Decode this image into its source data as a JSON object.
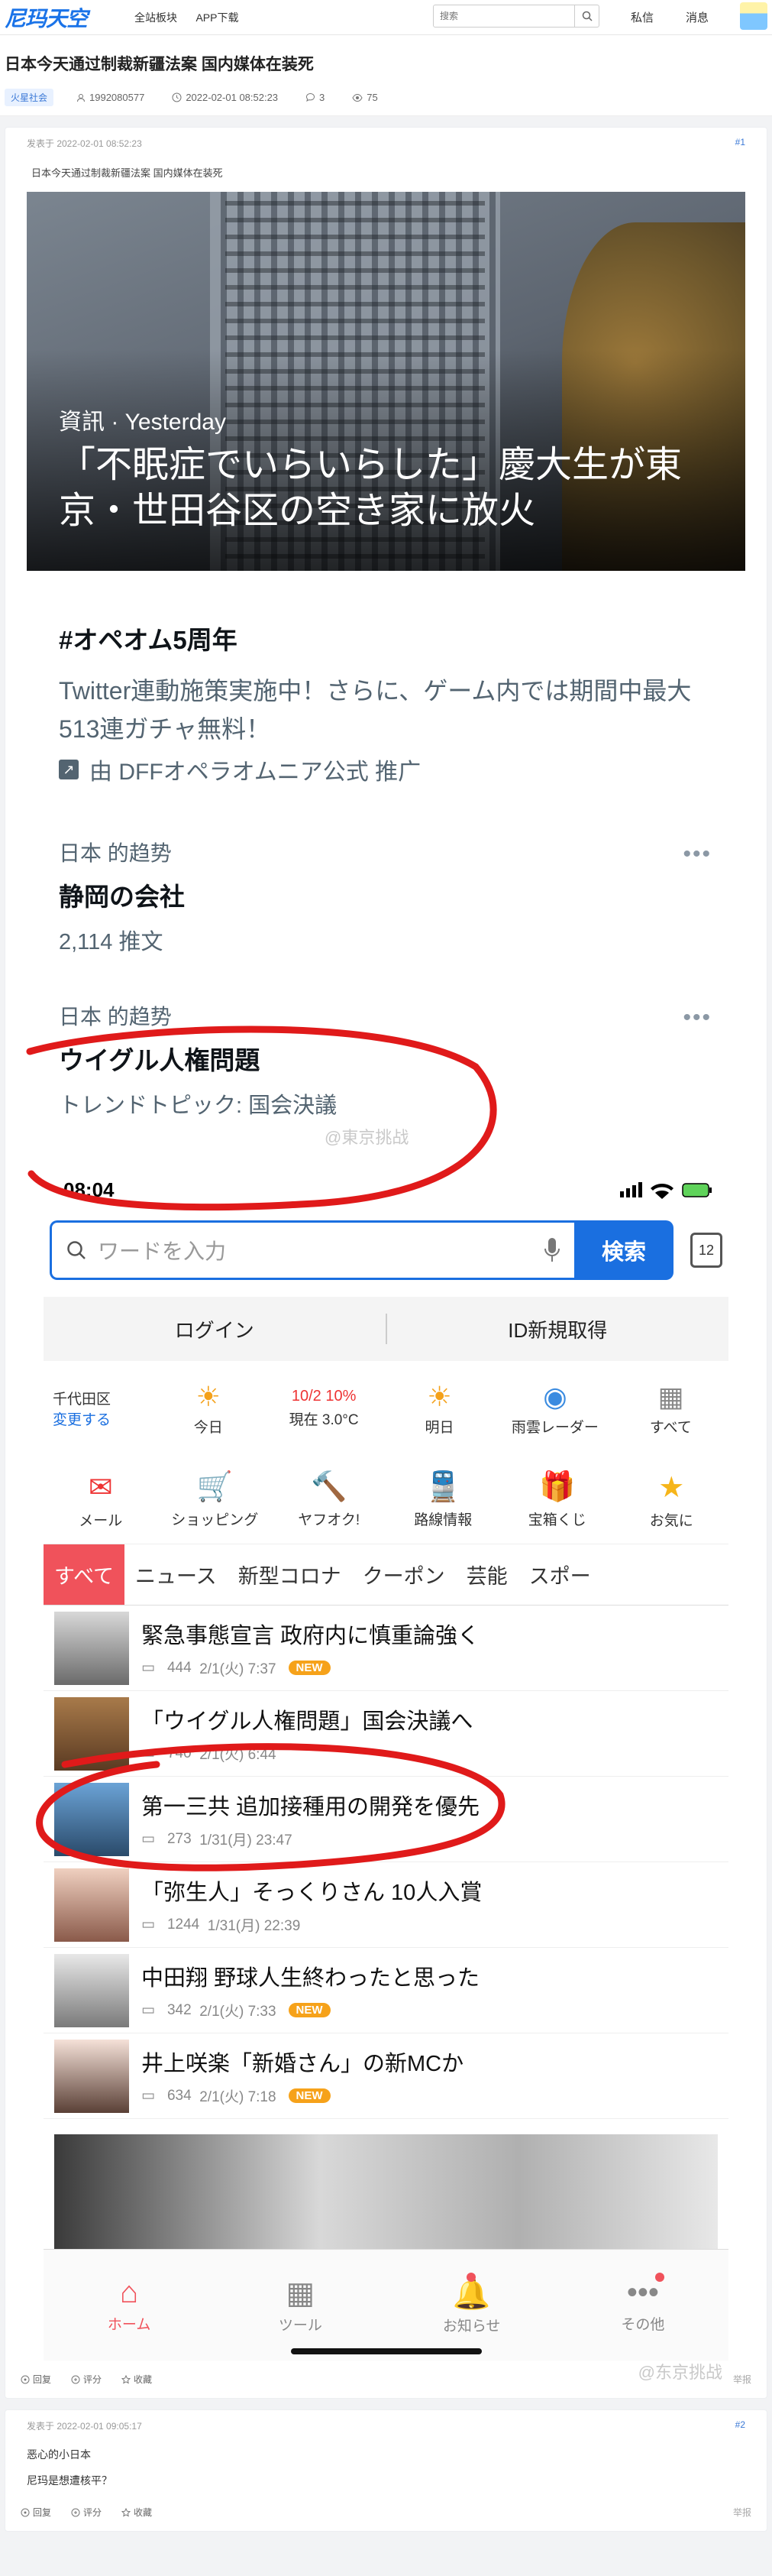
{
  "header": {
    "logo": "尼玛天空",
    "nav": [
      "全站板块",
      "APP下载"
    ],
    "search_placeholder": "搜索",
    "messages": "私信",
    "notices": "消息"
  },
  "thread": {
    "title": "日本今天通过制裁新疆法案 国内媒体在装死",
    "tag": "火星社会",
    "user": "1992080577",
    "time": "2022-02-01 08:52:23",
    "comments": "3",
    "views": "75"
  },
  "post1": {
    "posted": "发表于 2022-02-01 08:52:23",
    "floor": "#1",
    "caption": "日本今天通过制裁新疆法案 国内媒体在装死",
    "image": {
      "kicker": "資訊 · Yesterday",
      "headline": "「不眠症でいらいらした」慶大生が東京・世田谷区の空き家に放火",
      "promo_title": "#オペオム5周年",
      "promo_text": "Twitter連動施策実施中！さらに、ゲーム内では期間中最大513連ガチャ無料！",
      "promo_by": "由 DFFオペラオムニア公式 推广",
      "trend1": {
        "cat": "日本 的趋势",
        "name": "静岡の会社",
        "sub": "2,114 推文"
      },
      "trend2": {
        "cat": "日本 的趋势",
        "name": "ウイグル人権問題",
        "sub": "トレンドトピック: 国会決議"
      },
      "watermark1": "@東京挑战",
      "phone": {
        "time": "08:04",
        "search_placeholder": "ワードを入力",
        "search_btn": "検索",
        "tabs_count": "12",
        "login": "ログイン",
        "register": "ID新規取得",
        "area": "千代田区",
        "area_change": "変更する",
        "weather": [
          {
            "icon": "☀",
            "label": "今日",
            "extra": ""
          },
          {
            "icon": "",
            "label": "10/2 10%",
            "extra": "現在 3.0°C"
          },
          {
            "icon": "☀",
            "label": "明日",
            "extra": ""
          },
          {
            "icon": "◉",
            "label": "雨雲レーダー",
            "extra": ""
          },
          {
            "icon": "▦",
            "label": "すべて",
            "extra": ""
          }
        ],
        "services": [
          {
            "icon": "✉",
            "label": "メール"
          },
          {
            "icon": "🛒",
            "label": "ショッピング"
          },
          {
            "icon": "🔨",
            "label": "ヤフオク!"
          },
          {
            "icon": "🚆",
            "label": "路線情報"
          },
          {
            "icon": "🎁",
            "label": "宝箱くじ"
          },
          {
            "icon": "★",
            "label": "お気に"
          }
        ],
        "categories": [
          "すべて",
          "ニュース",
          "新型コロナ",
          "クーポン",
          "芸能",
          "スポー"
        ],
        "news": [
          {
            "title": "緊急事態宣言 政府内に慎重論強く",
            "count": "444",
            "date": "2/1(火) 7:37",
            "new": "NEW"
          },
          {
            "title": "「ウイグル人権問題」国会決議へ",
            "count": "740",
            "date": "2/1(火) 6:44",
            "new": ""
          },
          {
            "title": "第一三共 追加接種用の開発を優先",
            "count": "273",
            "date": "1/31(月) 23:47",
            "new": ""
          },
          {
            "title": "「弥生人」そっくりさん 10人入賞",
            "count": "1244",
            "date": "1/31(月) 22:39",
            "new": ""
          },
          {
            "title": "中田翔 野球人生終わったと思った",
            "count": "342",
            "date": "2/1(火) 7:33",
            "new": "NEW"
          },
          {
            "title": "井上咲楽「新婚さん」の新MCか",
            "count": "634",
            "date": "2/1(火) 7:18",
            "new": "NEW"
          }
        ],
        "bottom_nav": [
          "ホーム",
          "ツール",
          "お知らせ",
          "その他"
        ],
        "watermark2": "@东京挑战"
      }
    },
    "actions": [
      "回复",
      "评分",
      "收藏"
    ],
    "report": "举报"
  },
  "post2": {
    "posted": "发表于 2022-02-01 09:05:17",
    "floor": "#2",
    "lines": [
      "恶心的小日本",
      "尼玛是想遭核平？"
    ],
    "actions": [
      "回复",
      "评分",
      "收藏"
    ],
    "report": "举报"
  }
}
